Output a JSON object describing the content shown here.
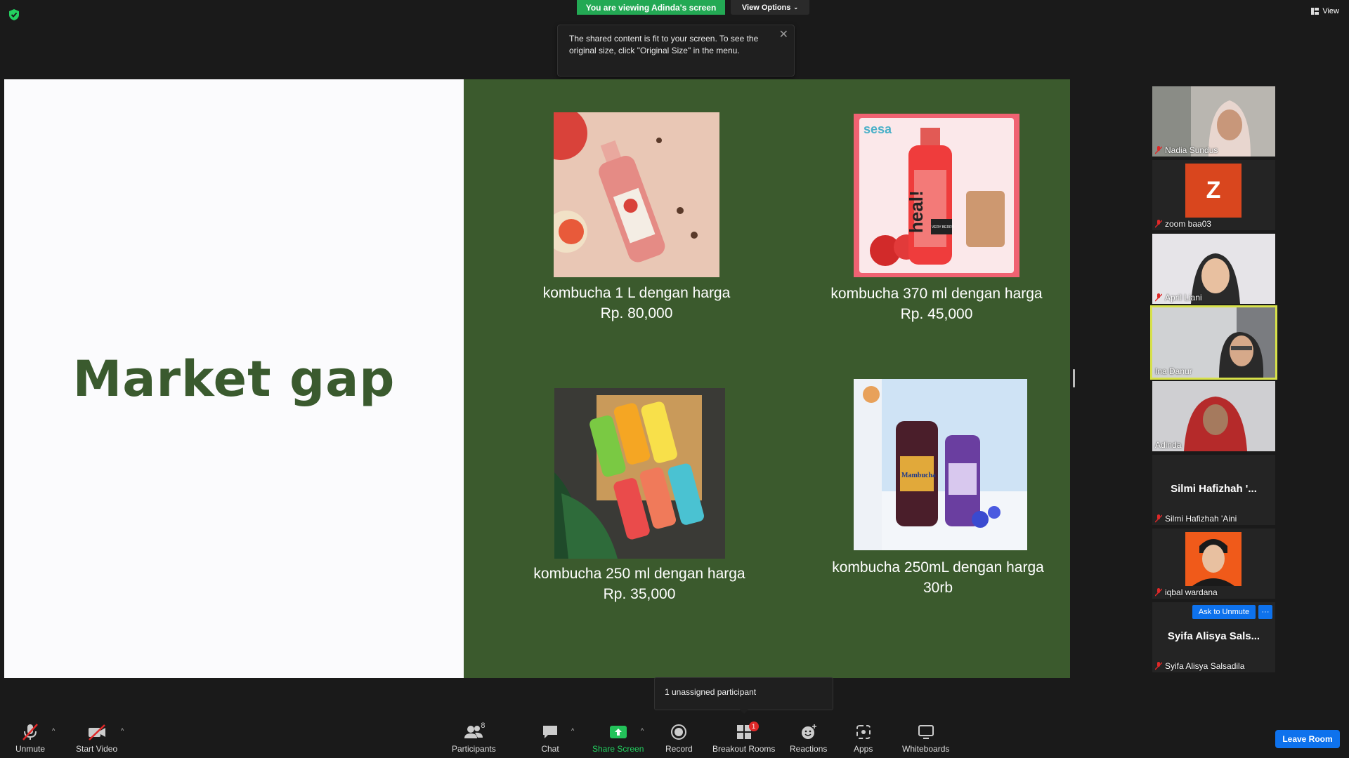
{
  "app": {
    "viewing_banner": "You are viewing Adinda's screen",
    "view_options": "View Options",
    "view_label": "View",
    "accent": "#0e72ed",
    "banner_color": "#23a954"
  },
  "tooltip": {
    "text": "The shared content is fit to your screen. To see the original size, click \"Original Size\" in the menu."
  },
  "slide": {
    "title": "Market gap",
    "products": [
      {
        "line1": "kombucha 1 L dengan harga",
        "line2": "Rp. 80,000"
      },
      {
        "line1": "kombucha 370 ml dengan harga",
        "line2": "Rp. 45,000"
      },
      {
        "line1": "kombucha 250 ml dengan harga",
        "line2": "Rp. 35,000"
      },
      {
        "line1": "kombucha 250mL dengan harga",
        "line2": "30rb"
      }
    ],
    "product2_brand": "sesa",
    "product2_bottle_text": "heal!",
    "product2_bottle_sub": "VERY BERRY",
    "product4_bottle_text": "Mambucha"
  },
  "participants": [
    {
      "name": "Nadia Sundus",
      "muted": true
    },
    {
      "name": "zoom baa03",
      "initial": "Z",
      "muted": true
    },
    {
      "name": "April Liani",
      "muted": true
    },
    {
      "name": "Ina Danur",
      "muted": false
    },
    {
      "name": "Adinda",
      "muted": false
    },
    {
      "display": "Silmi  Hafizhah  '...",
      "name": "Silmi Hafizhah 'Aini",
      "muted": true
    },
    {
      "name": "iqbal wardana",
      "muted": true
    },
    {
      "display": "Syifa Alisya Sals...",
      "name": "Syifa Alisya Salsadila",
      "muted": true
    }
  ],
  "ask_to_unmute": "Ask to Unmute",
  "more": "···",
  "unassigned": "1 unassigned participant",
  "toolbar": {
    "unmute": "Unmute",
    "start_video": "Start Video",
    "participants": "Participants",
    "participants_count": "8",
    "chat": "Chat",
    "share_screen": "Share Screen",
    "record": "Record",
    "breakout_rooms": "Breakout Rooms",
    "breakout_badge": "1",
    "reactions": "Reactions",
    "apps": "Apps",
    "whiteboards": "Whiteboards",
    "leave_room": "Leave Room"
  }
}
